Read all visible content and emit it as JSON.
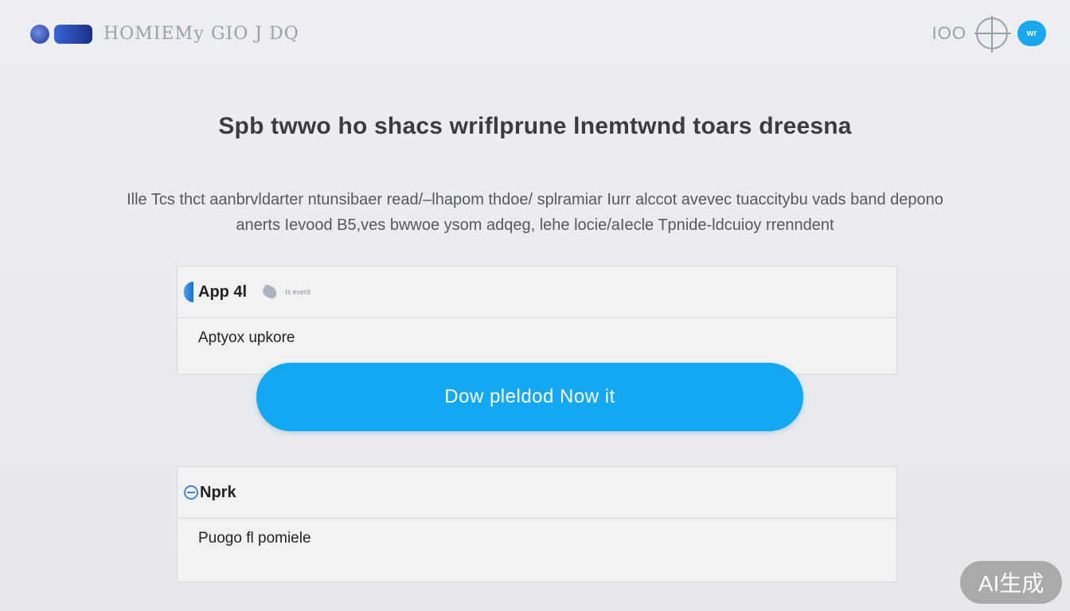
{
  "header": {
    "brand_name": "HOMIEМу GIO J DQ",
    "right_label": "IOO",
    "user_badge": "wr"
  },
  "main": {
    "title": "Spb twwo ho shacs wriflprune lnemtwnd toars dreesna",
    "description": "Ille Tcs thct aanbrvldarter ntunsibaer read/–lhapom thdoe/ splramiar Iurr alccot avevec tuaccitybu vads band depono anerts Ievood B5,ves bwwoe ysom adqeg, lehe locie/aIecle Tpnide-ldcuioy rrenndent"
  },
  "card1": {
    "title": "App 4l",
    "caption": "Is event",
    "subtitle": "Aptyox upkore"
  },
  "cta": {
    "label": "Dow pleldod Now  it"
  },
  "card2": {
    "title": "Nprk",
    "subtitle": "Puogo fl pomiele"
  },
  "watermark": {
    "label": "AI生成"
  },
  "icons": {
    "brand": "logo-icon",
    "globe": "globe-icon",
    "app": "app-icon",
    "hand": "hand-icon",
    "card2": "circle-icon"
  },
  "colors": {
    "accent": "#14a8f2",
    "background": "#e9ebef",
    "card": "#f1f2f4",
    "watermark": "#969696"
  }
}
